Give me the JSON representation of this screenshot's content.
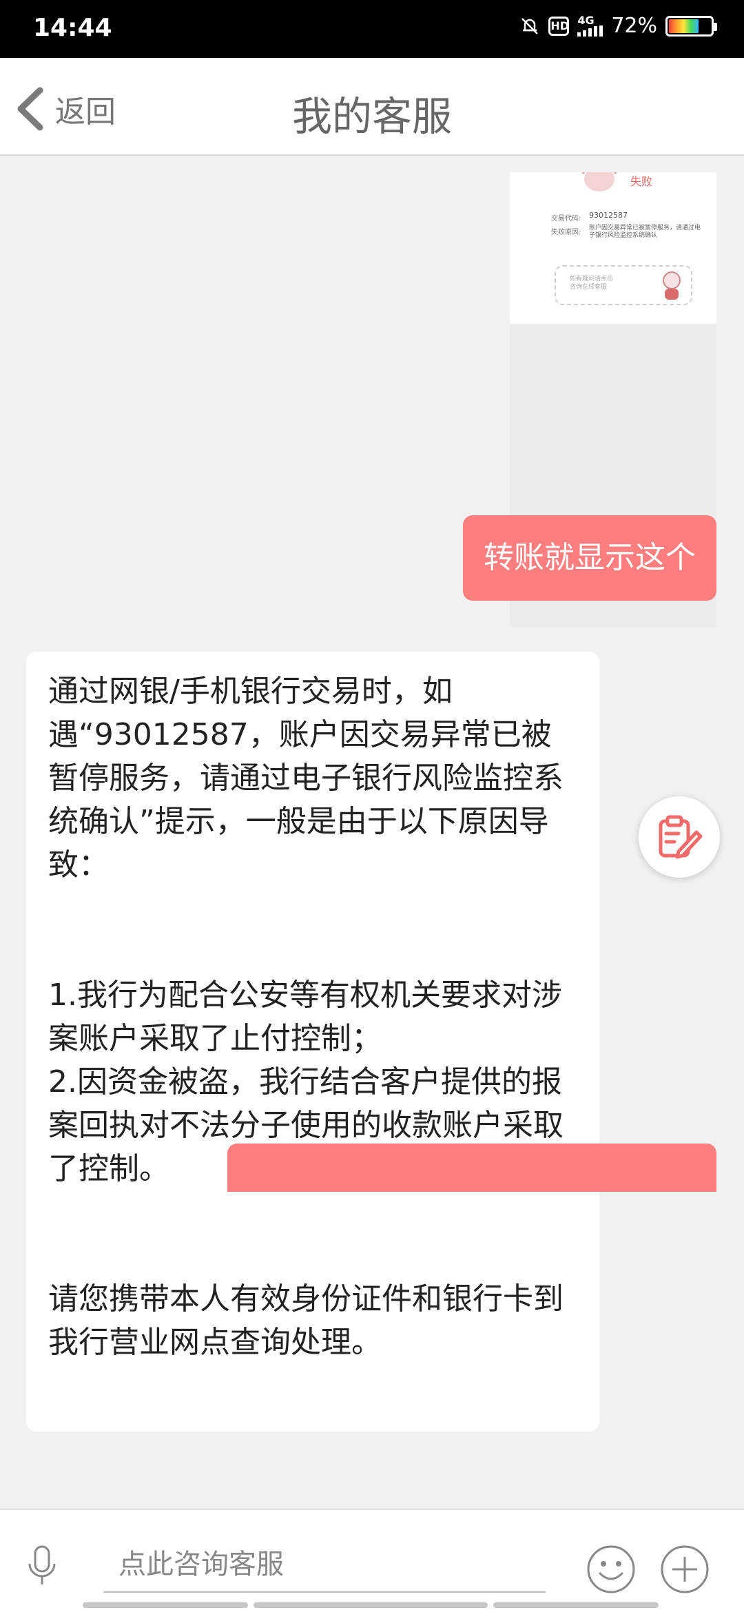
{
  "status_bar": {
    "time": "14:44",
    "network": "4G",
    "hd": "HD",
    "battery_percent": "72%",
    "battery_level": 0.72
  },
  "header": {
    "back_label": "返回",
    "title": "我的客服"
  },
  "thumbnail": {
    "title": "失败",
    "code_label": "交易代码:",
    "code": "93012587",
    "desc_label": "失败原因:",
    "desc": "账户因交易异常已被暂停服务，请通过电子银行风险监控系统确认",
    "box_text": "如有疑问请点击\n咨询在线客服"
  },
  "messages": {
    "user_1": "转账就显示这个",
    "agent_1": "通过网银/手机银行交易时，如遇“93012587，账户因交易异常已被暂停服务，请通过电子银行风险监控系统确认”提示，一般是由于以下原因导致：\n\n\n1.我行为配合公安等有权机关要求对涉案账户采取了止付控制；\n2.因资金被盗，我行结合客户提供的报案回执对不法分子使用的收款账户采取了控制。\n\n\n请您携带本人有效身份证件和银行卡到我行营业网点查询处理。"
  },
  "input_bar": {
    "placeholder": "点此咨询客服"
  },
  "icons": {
    "mic": "microphone-icon",
    "emoji": "smiley-icon",
    "plus": "plus-icon",
    "float": "clipboard-edit-icon"
  },
  "colors": {
    "accent": "#fd7e7e",
    "float_icon": "#f06a6a"
  }
}
